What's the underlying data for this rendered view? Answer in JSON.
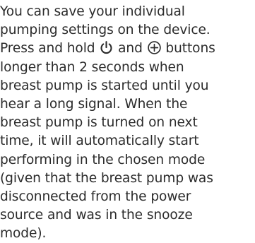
{
  "instruction": {
    "lines": [
      "You can save your individual",
      "pumping settings on the device.",
      {
        "before": "Press and hold ",
        "icon1": "power-icon",
        "middle": " and ",
        "icon2": "plus-circle-icon",
        "after": " buttons"
      },
      "longer than 2 seconds when",
      "breast pump is started until you",
      "hear a long signal. When the",
      "breast pump is turned on next",
      "time, it will automatically start",
      "performing in the chosen mode",
      "(given that the breast pump was",
      "disconnected from the power",
      "source and was in the snooze",
      "mode)."
    ]
  },
  "colors": {
    "text": "#2b2b2b",
    "background": "#ffffff"
  }
}
